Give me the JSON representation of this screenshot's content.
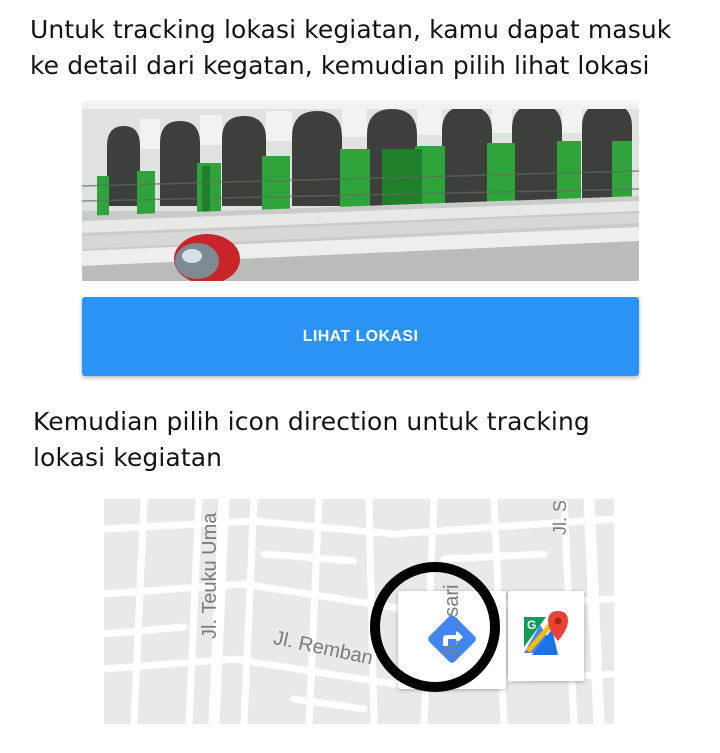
{
  "instructions": {
    "step1": "Untuk tracking lokasi kegiatan, kamu dapat masuk ke detail dari kegatan, kemudian pilih lihat lokasi",
    "step2": "Kemudian pilih icon direction untuk tracking lokasi kegiatan"
  },
  "location_button": {
    "label": "LIHAT LOKASI"
  },
  "map": {
    "street_labels": {
      "teuku": "Jl. Teuku Uma",
      "rembang": "Jl. Remban",
      "sari": "Jl. ...sari",
      "top": "Jl. S"
    },
    "directions_icon": "directions-icon",
    "maps_app_icon": "google-maps-icon"
  },
  "colors": {
    "button": "#2b93f5",
    "directions": "#4285f4",
    "highlight_circle": "#000000"
  }
}
